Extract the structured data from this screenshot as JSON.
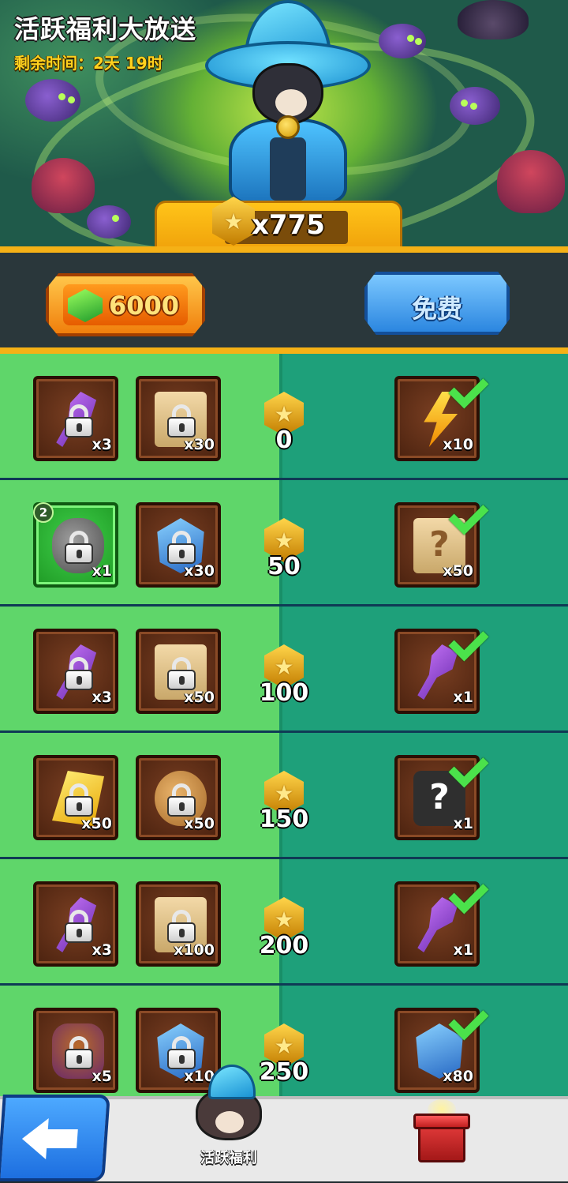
{
  "header": {
    "title": "活跃福利大放送",
    "timer": "剩余时间：2天 19时",
    "star_count": "x775"
  },
  "actions": {
    "gem_cost": "6000",
    "free_label": "免费"
  },
  "rows": [
    {
      "level": "0",
      "left": [
        {
          "item": "purple-key-icon",
          "qty": "x3"
        },
        {
          "item": "scroll-icon",
          "qty": "x30"
        }
      ],
      "reward": {
        "item": "lightning-bolt-icon",
        "qty": "x10"
      }
    },
    {
      "level": "50",
      "left": [
        {
          "item": "stone-icon",
          "qty": "x1",
          "badge": "2"
        },
        {
          "item": "blue-crystal-icon",
          "qty": "x30"
        }
      ],
      "reward": {
        "item": "mystery-scroll-icon",
        "qty": "x50"
      }
    },
    {
      "level": "100",
      "left": [
        {
          "item": "purple-key-icon",
          "qty": "x3"
        },
        {
          "item": "scroll-icon",
          "qty": "x50"
        }
      ],
      "reward": {
        "item": "purple-key-icon",
        "qty": "x1"
      }
    },
    {
      "level": "150",
      "left": [
        {
          "item": "gold-bar-icon",
          "qty": "x50"
        },
        {
          "item": "cookie-icon",
          "qty": "x50"
        }
      ],
      "reward": {
        "item": "mystery-puzzle-icon",
        "qty": "x1"
      }
    },
    {
      "level": "200",
      "left": [
        {
          "item": "purple-key-icon",
          "qty": "x3"
        },
        {
          "item": "scroll-icon",
          "qty": "x100"
        }
      ],
      "reward": {
        "item": "purple-key-icon",
        "qty": "x1"
      }
    },
    {
      "level": "250",
      "left": [
        {
          "item": "character-icon",
          "qty": "x5"
        },
        {
          "item": "blue-crystal-icon",
          "qty": "x10"
        }
      ],
      "reward": {
        "item": "blue-crystal-icon",
        "qty": "x80"
      }
    }
  ],
  "bottom_nav": {
    "active_label": "活跃福利"
  },
  "colors": {
    "accent_gold": "#f5b116",
    "left_panel": "#5fd66a",
    "right_panel": "#1ea07a",
    "free_blue": "#2b86e0",
    "gem_orange": "#f07f0c"
  }
}
